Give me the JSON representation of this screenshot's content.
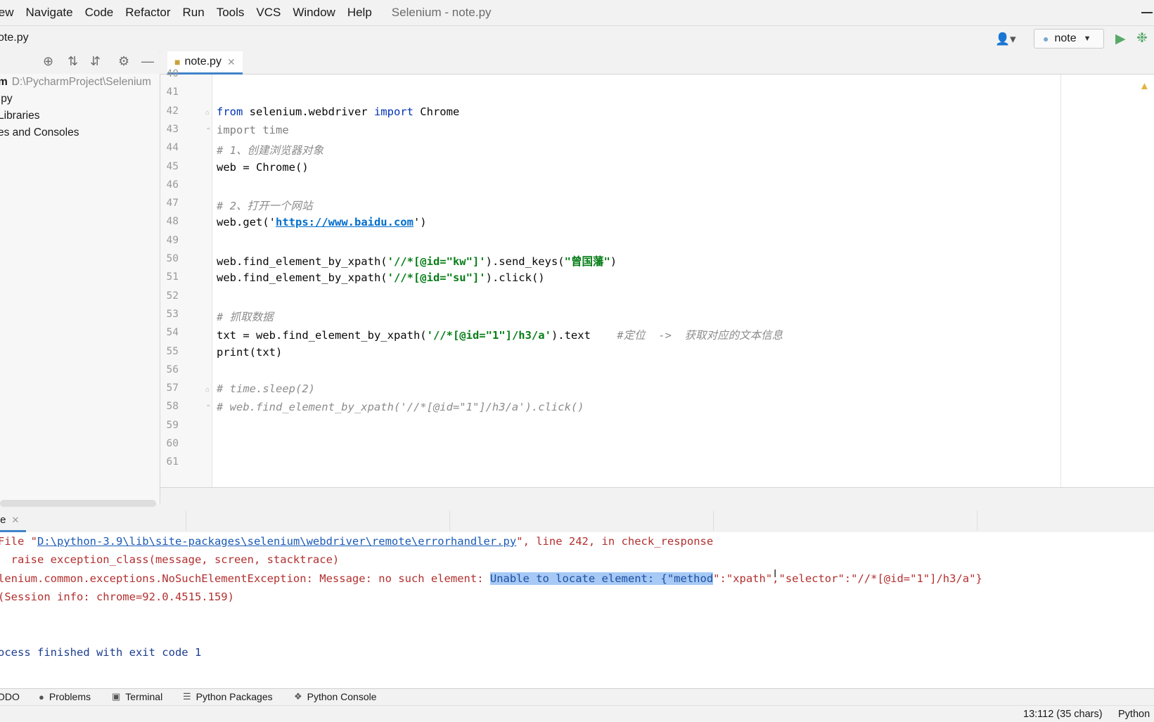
{
  "menu": {
    "items": [
      "iew",
      "Navigate",
      "Code",
      "Refactor",
      "Run",
      "Tools",
      "VCS",
      "Window",
      "Help"
    ],
    "window_title": "Selenium - note.py"
  },
  "navbar": {
    "breadcrumb": "ote.py",
    "run_config": "note"
  },
  "project": {
    "root_name": "m",
    "root_path": "D:\\PycharmProject\\Selenium",
    "items": [
      ".py",
      " Libraries",
      "es and Consoles"
    ]
  },
  "editor": {
    "tab_label": "note.py",
    "lines": [
      {
        "n": "40",
        "code": []
      },
      {
        "n": "41",
        "code": []
      },
      {
        "n": "42",
        "code": [
          {
            "t": "from",
            "c": "kw"
          },
          {
            "t": " selenium.webdriver ",
            "c": ""
          },
          {
            "t": "import",
            "c": "kw"
          },
          {
            "t": " Chrome",
            "c": ""
          }
        ]
      },
      {
        "n": "43",
        "code": [
          {
            "t": "import",
            "c": "kw-dim"
          },
          {
            "t": " time",
            "c": "kw-dim"
          }
        ]
      },
      {
        "n": "44",
        "code": [
          {
            "t": "# 1、创建浏览器对象",
            "c": "cm"
          }
        ]
      },
      {
        "n": "45",
        "code": [
          {
            "t": "web = Chrome()",
            "c": ""
          }
        ]
      },
      {
        "n": "46",
        "code": []
      },
      {
        "n": "47",
        "code": [
          {
            "t": "# 2、打开一个网站",
            "c": "cm"
          }
        ]
      },
      {
        "n": "48",
        "code": [
          {
            "t": "web.get('",
            "c": ""
          },
          {
            "t": "https://www.baidu.com",
            "c": "url"
          },
          {
            "t": "')",
            "c": ""
          }
        ]
      },
      {
        "n": "49",
        "code": []
      },
      {
        "n": "50",
        "code": [
          {
            "t": "web.find_element_by_xpath(",
            "c": ""
          },
          {
            "t": "'//*[@id=\"kw\"]'",
            "c": "str"
          },
          {
            "t": ").send_keys(",
            "c": ""
          },
          {
            "t": "\"曾国藩\"",
            "c": "str"
          },
          {
            "t": ")",
            "c": ""
          }
        ]
      },
      {
        "n": "51",
        "code": [
          {
            "t": "web.find_element_by_xpath(",
            "c": ""
          },
          {
            "t": "'//*[@id=\"su\"]'",
            "c": "str"
          },
          {
            "t": ").click()",
            "c": ""
          }
        ]
      },
      {
        "n": "52",
        "code": []
      },
      {
        "n": "53",
        "code": [
          {
            "t": "# 抓取数据",
            "c": "cm"
          }
        ]
      },
      {
        "n": "54",
        "code": [
          {
            "t": "txt = web.find_element_by_xpath(",
            "c": ""
          },
          {
            "t": "'//*[@id=\"1\"]/h3/a'",
            "c": "str"
          },
          {
            "t": ").text    ",
            "c": ""
          },
          {
            "t": "#定位  ->  获取对应的文本信息",
            "c": "cm"
          }
        ]
      },
      {
        "n": "55",
        "code": [
          {
            "t": "print(txt)",
            "c": ""
          }
        ]
      },
      {
        "n": "56",
        "code": []
      },
      {
        "n": "57",
        "code": [
          {
            "t": "# time.sleep(2)",
            "c": "cm"
          }
        ]
      },
      {
        "n": "58",
        "code": [
          {
            "t": "# web.find_element_by_xpath('//*[@id=\"1\"]/h3/a').click()",
            "c": "cm"
          }
        ]
      },
      {
        "n": "59",
        "code": []
      },
      {
        "n": "60",
        "code": []
      },
      {
        "n": "61",
        "code": []
      }
    ]
  },
  "run": {
    "tab_label": "te",
    "console": [
      [
        {
          "t": "File \"",
          "c": "err"
        },
        {
          "t": "D:\\python-3.9\\lib\\site-packages\\selenium\\webdriver\\remote\\errorhandler.py",
          "c": "link"
        },
        {
          "t": "\", line 242, in check_response",
          "c": "err"
        }
      ],
      [
        {
          "t": "  raise exception_class(message, screen, stacktrace)",
          "c": "err"
        }
      ],
      [
        {
          "t": "lenium.common.exceptions.NoSuchElementException: Message: no such element: ",
          "c": "err"
        },
        {
          "t": "Unable to locate element: {\"method",
          "c": "sel"
        },
        {
          "t": "\":\"xpath\",\"selector\":\"//*[@id=\"1\"]/h3/a\"}",
          "c": "err"
        }
      ],
      [
        {
          "t": "(Session info: chrome=92.0.4515.159)",
          "c": "err"
        }
      ],
      [],
      [],
      [
        {
          "t": "ocess finished with exit code 1",
          "c": "ok"
        }
      ]
    ]
  },
  "bottom_tools": [
    "ODO",
    "Problems",
    "Terminal",
    "Python Packages",
    "Python Console"
  ],
  "status": {
    "caret": "13:112 (35 chars)",
    "file_type": "Python"
  }
}
